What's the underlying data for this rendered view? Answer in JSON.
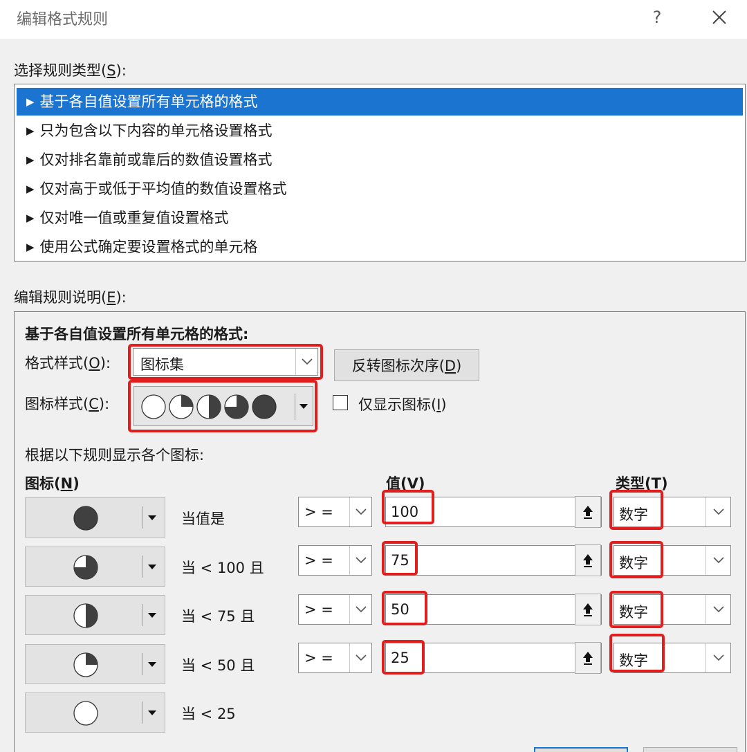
{
  "dialog": {
    "title": "编辑格式规则",
    "help_label": "?"
  },
  "rule_type": {
    "label_prefix": "选择规则类型(",
    "label_key": "S",
    "label_suffix": "):",
    "items": [
      {
        "label": "基于各自值设置所有单元格的格式",
        "selected": true
      },
      {
        "label": "只为包含以下内容的单元格设置格式",
        "selected": false
      },
      {
        "label": "仅对排名靠前或靠后的数值设置格式",
        "selected": false
      },
      {
        "label": "仅对高于或低于平均值的数值设置格式",
        "selected": false
      },
      {
        "label": "仅对唯一值或重复值设置格式",
        "selected": false
      },
      {
        "label": "使用公式确定要设置格式的单元格",
        "selected": false
      }
    ]
  },
  "description": {
    "label_prefix": "编辑规则说明(",
    "label_key": "E",
    "label_suffix": "):",
    "heading": "基于各自值设置所有单元格的格式:",
    "format_style_prefix": "格式样式(",
    "format_style_key": "O",
    "format_style_suffix": "):",
    "format_style_value": "图标集",
    "reverse_button_prefix": "反转图标次序(",
    "reverse_button_key": "D",
    "reverse_button_suffix": ")",
    "icon_style_prefix": "图标样式(",
    "icon_style_key": "C",
    "icon_style_suffix": "):",
    "icon_style_fractions": [
      0,
      0.25,
      0.5,
      0.75,
      1
    ],
    "show_icon_only_prefix": "仅显示图标(",
    "show_icon_only_key": "I",
    "show_icon_only_suffix": ")",
    "show_icon_only_checked": false,
    "rules_caption": "根据以下规则显示各个图标:",
    "col_icon_prefix": "图标(",
    "col_icon_key": "N",
    "col_icon_suffix": ")",
    "col_value_prefix": "值(",
    "col_value_key": "V",
    "col_value_suffix": ")",
    "col_type_prefix": "类型(",
    "col_type_key": "T",
    "col_type_suffix": ")",
    "rows": [
      {
        "icon_fraction": 1,
        "condition": "当值是",
        "operator": "> =",
        "value": "100",
        "type": "数字"
      },
      {
        "icon_fraction": 0.75,
        "condition": "当 < 100 且",
        "operator": "> =",
        "value": "75",
        "type": "数字"
      },
      {
        "icon_fraction": 0.5,
        "condition": "当 < 75 且",
        "operator": "> =",
        "value": "50",
        "type": "数字"
      },
      {
        "icon_fraction": 0.25,
        "condition": "当 < 50 且",
        "operator": "> =",
        "value": "25",
        "type": "数字"
      },
      {
        "icon_fraction": 0,
        "condition": "当 < 25"
      }
    ]
  },
  "colors": {
    "selection": "#1b74cf",
    "highlight_box": "#e01e1e",
    "icon_fill": "#404040"
  }
}
